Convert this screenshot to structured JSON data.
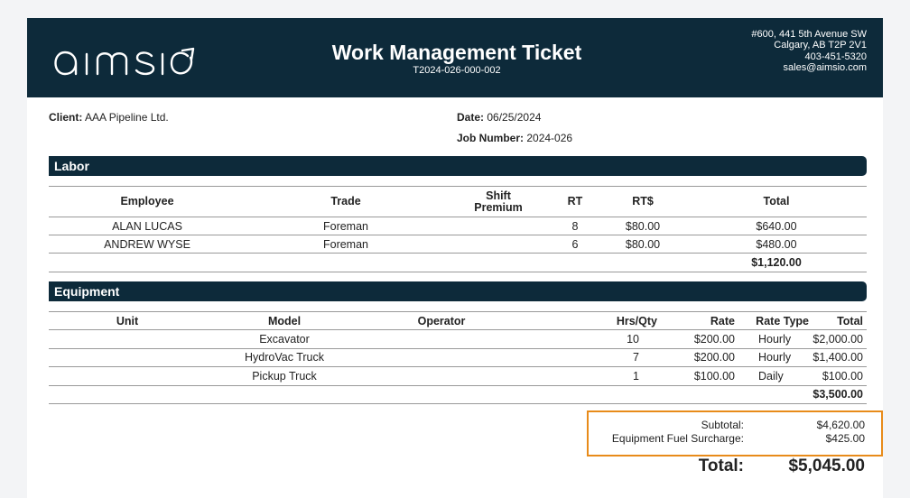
{
  "brand": {
    "name": "aimsio"
  },
  "header": {
    "title": "Work Management Ticket",
    "ticket_number": "T2024-026-000-002",
    "address": [
      "#600, 441 5th Avenue SW",
      "Calgary, AB T2P 2V1",
      "403-451-5320",
      "sales@aimsio.com"
    ]
  },
  "info": {
    "client_label": "Client:",
    "client": "AAA Pipeline Ltd.",
    "date_label": "Date:",
    "date": "06/25/2024",
    "job_label": "Job Number:",
    "job": "2024-026"
  },
  "labor": {
    "title": "Labor",
    "headers": [
      "Employee",
      "Trade",
      "Shift Premium",
      "RT",
      "RT$",
      "Total"
    ],
    "rows": [
      [
        "ALAN LUCAS",
        "Foreman",
        "",
        "8",
        "$80.00",
        "$640.00"
      ],
      [
        "ANDREW WYSE",
        "Foreman",
        "",
        "6",
        "$80.00",
        "$480.00"
      ]
    ],
    "total": "$1,120.00"
  },
  "equipment": {
    "title": "Equipment",
    "headers": [
      "Unit",
      "Model",
      "Operator",
      "Hrs/Qty",
      "Rate",
      "Rate Type",
      "Total"
    ],
    "rows": [
      [
        "",
        "Excavator",
        "",
        "10",
        "$200.00",
        "Hourly",
        "$2,000.00"
      ],
      [
        "",
        "HydroVac Truck",
        "",
        "7",
        "$200.00",
        "Hourly",
        "$1,400.00"
      ],
      [
        "",
        "Pickup Truck",
        "",
        "1",
        "$100.00",
        "Daily",
        "$100.00"
      ]
    ],
    "total": "$3,500.00"
  },
  "summary": {
    "subtotal_label": "Subtotal:",
    "subtotal": "$4,620.00",
    "surcharge_label": "Equipment Fuel Surcharge:",
    "surcharge": "$425.00",
    "total_label": "Total:",
    "total": "$5,045.00"
  },
  "colors": {
    "header_bg": "#0d2a3a",
    "highlight_border": "#e88b1a"
  }
}
